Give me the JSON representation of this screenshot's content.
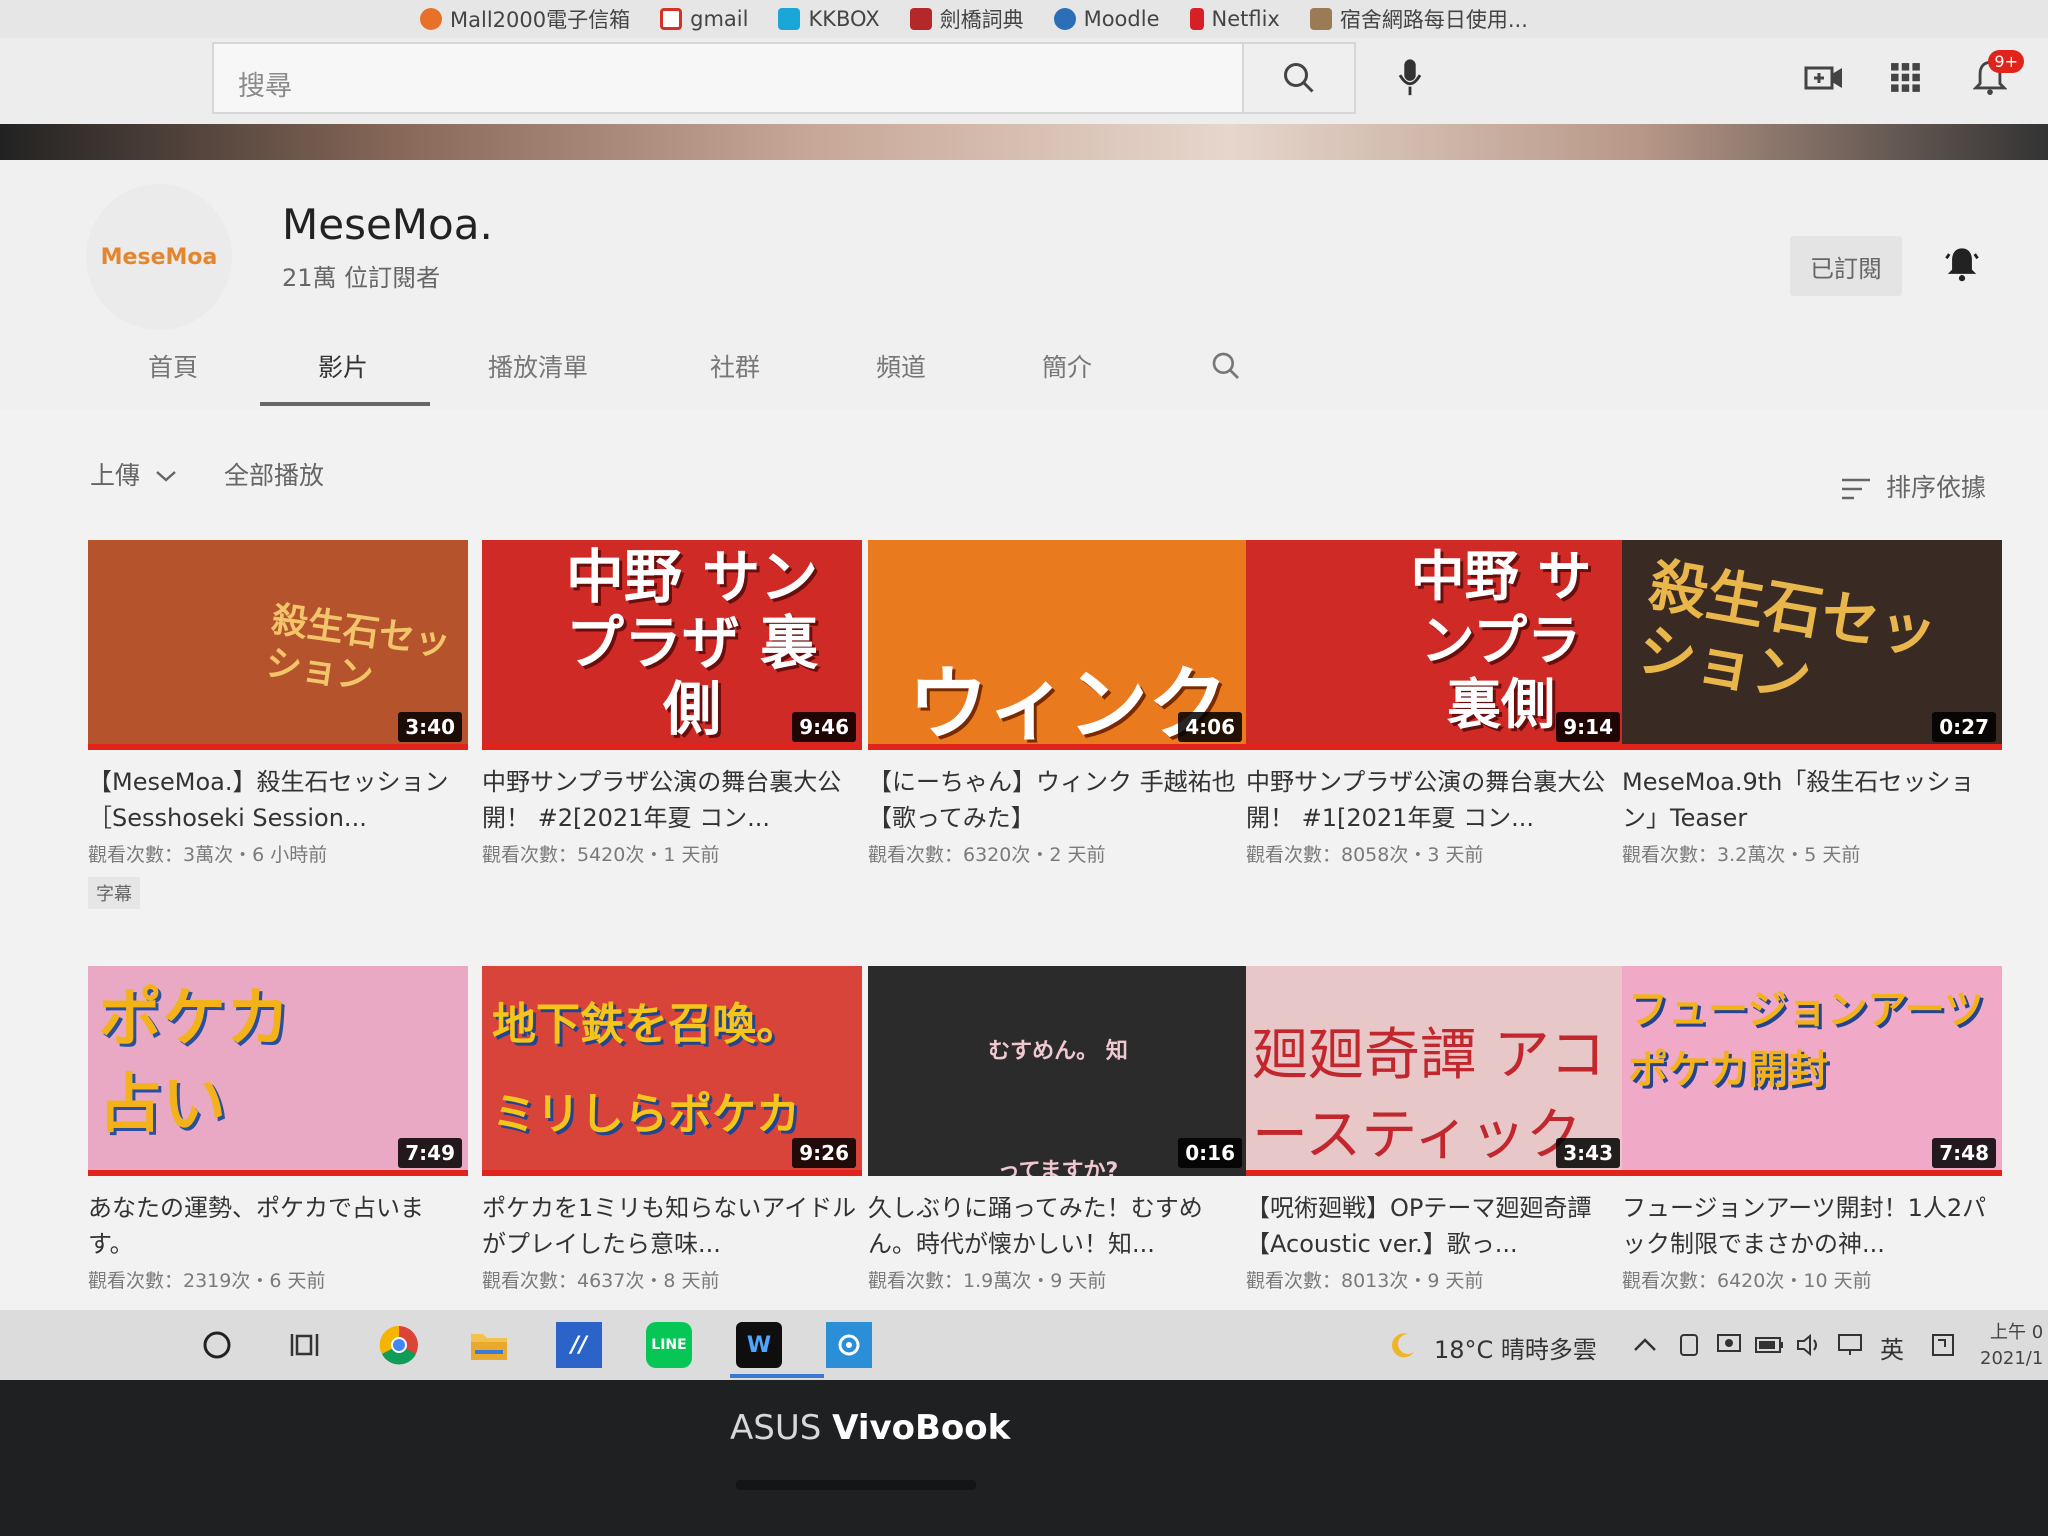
{
  "bookmarks": [
    {
      "label": "Mall2000電子信箱",
      "color": "#e8712a"
    },
    {
      "label": "gmail",
      "color": "#d93025"
    },
    {
      "label": "KKBOX",
      "color": "#1aa6d6"
    },
    {
      "label": "劍橋詞典",
      "color": "#b5282a"
    },
    {
      "label": "Moodle",
      "color": "#2b6fb6"
    },
    {
      "label": "Netflix",
      "color": "#d81f26"
    },
    {
      "label": "宿舍網路每日使用...",
      "color": "#9a7b56"
    }
  ],
  "header": {
    "search_placeholder": "搜尋",
    "notifications_badge": "9+"
  },
  "channel": {
    "avatar_text": "MeseMoa",
    "name": "MeseMoa.",
    "subscribers": "21萬 位訂閱者",
    "subscribed_label": "已訂閱"
  },
  "tabs": [
    "首頁",
    "影片",
    "播放清單",
    "社群",
    "頻道",
    "簡介"
  ],
  "active_tab": "影片",
  "filters": {
    "uploads": "上傳",
    "play_all": "全部播放",
    "sort": "排序依據"
  },
  "videos": [
    {
      "title": "【MeseMoa.】殺生石セッション［Sesshoseki Session...",
      "meta": "觀看次數：3萬次・6 小時前",
      "duration": "3:40",
      "badge": "字幕",
      "thumb_text": "殺生石セッション",
      "thumb_bg": "#b5532d",
      "thumb_text_color": "#f2c56a",
      "progress": 1.0
    },
    {
      "title": "中野サンプラザ公演の舞台裏大公開！ #2[2021年夏 コン...",
      "meta": "觀看次數：5420次・1 天前",
      "duration": "9:46",
      "thumb_text": "中野 サンプラザ 裏側",
      "thumb_bg": "#cf2a25",
      "thumb_text_color": "#ffffff",
      "progress": 1.0
    },
    {
      "title": "【にーちゃん】ウィンク 手越祐也【歌ってみた】",
      "meta": "觀看次數：6320次・2 天前",
      "duration": "4:06",
      "thumb_text": "ウィンク",
      "thumb_bg": "#ea7a1e",
      "thumb_text_color": "#ffffff",
      "progress": 1.0
    },
    {
      "title": "中野サンプラザ公演の舞台裏大公開！ #1[2021年夏 コン...",
      "meta": "觀看次數：8058次・3 天前",
      "duration": "9:14",
      "thumb_text": "中野 サンプラ 裏側",
      "thumb_bg": "#cf2a25",
      "thumb_text_color": "#ffffff",
      "progress": 1.0
    },
    {
      "title": "MeseMoa.9th「殺生石セッション」Teaser",
      "meta": "觀看次數：3.2萬次・5 天前",
      "duration": "0:27",
      "thumb_text": "殺生石セッション",
      "thumb_bg": "#3a2a24",
      "thumb_text_color": "#e8b64a",
      "progress": 1.0
    },
    {
      "title": "あなたの運勢、ポケカで占います。",
      "meta": "觀看次數：2319次・6 天前",
      "duration": "7:49",
      "thumb_text": "ポケカ 占い",
      "thumb_bg": "#e9a9c4",
      "thumb_text_color": "#f3b21a",
      "progress": 1.0
    },
    {
      "title": "ポケカを1ミリも知らないアイドルがプレイしたら意味...",
      "meta": "觀看次數：4637次・8 天前",
      "duration": "9:26",
      "thumb_text": "地下鉄を召喚。 ミリしらポケカ",
      "thumb_bg": "#d9443a",
      "thumb_text_color": "#f6c51c",
      "progress": 1.0
    },
    {
      "title": "久しぶりに踊ってみた！むすめん。時代が懐かしい！知...",
      "meta": "觀看次數：1.9萬次・9 天前",
      "duration": "0:16",
      "thumb_text": "むすめん。 知ってますか?",
      "thumb_bg": "#2b2b2b",
      "thumb_text_color": "#f0c8d0",
      "progress": 0.0
    },
    {
      "title": "【呪術廻戦】OPテーマ廻廻奇譚【Acoustic ver.】歌っ...",
      "meta": "觀看次數：8013次・9 天前",
      "duration": "3:43",
      "thumb_text": "廻廻奇譚 アコースティック",
      "thumb_bg": "#e7c7c7",
      "thumb_text_color": "#c2272d",
      "progress": 1.0
    },
    {
      "title": "フュージョンアーツ開封！1人2パック制限でまさかの神...",
      "meta": "觀看次數：6420次・10 天前",
      "duration": "7:48",
      "thumb_text": "フュージョンアーツ ポケカ開封",
      "thumb_bg": "#f0a9c6",
      "thumb_text_color": "#f3b21a",
      "progress": 1.0
    }
  ],
  "taskbar": {
    "weather": "18°C 晴時多雲",
    "ime": "英",
    "clock_time": "上午 0",
    "clock_date": "2021/1"
  },
  "laptop": {
    "brand": "ASUS",
    "model": "VivoBook"
  }
}
